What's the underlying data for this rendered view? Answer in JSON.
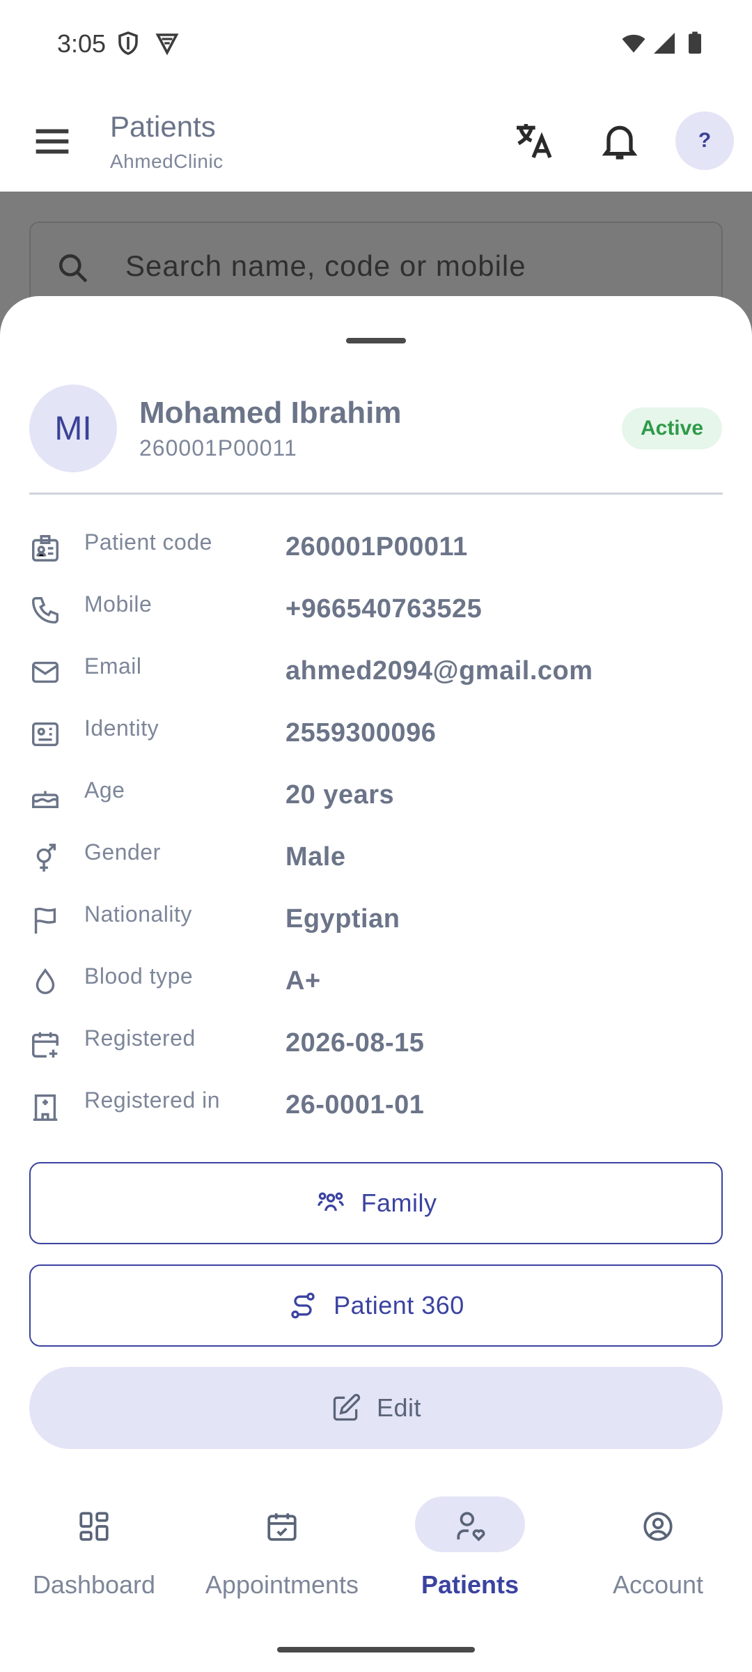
{
  "status_bar": {
    "time": "3:05"
  },
  "app_bar": {
    "title": "Patients",
    "subtitle": "AhmedClinic",
    "help_label": "?"
  },
  "search": {
    "placeholder": "Search name, code or mobile"
  },
  "patient": {
    "initials": "MI",
    "name": "Mohamed Ibrahim",
    "code": "260001P00011",
    "status": "Active"
  },
  "details": [
    {
      "icon": "id-badge-icon",
      "label": "Patient code",
      "value": "260001P00011"
    },
    {
      "icon": "phone-icon",
      "label": "Mobile",
      "value": "+966540763525"
    },
    {
      "icon": "mail-icon",
      "label": "Email",
      "value": "ahmed2094@gmail.com"
    },
    {
      "icon": "id-card-icon",
      "label": "Identity",
      "value": "2559300096"
    },
    {
      "icon": "cake-icon",
      "label": "Age",
      "value": "20 years"
    },
    {
      "icon": "gender-icon",
      "label": "Gender",
      "value": "Male"
    },
    {
      "icon": "flag-icon",
      "label": "Nationality",
      "value": "Egyptian"
    },
    {
      "icon": "droplet-icon",
      "label": "Blood type",
      "value": "A+"
    },
    {
      "icon": "calendar-plus-icon",
      "label": "Registered",
      "value": "2026-08-15"
    },
    {
      "icon": "hospital-icon",
      "label": "Registered in",
      "value": "26-0001-01"
    }
  ],
  "actions": {
    "family": "Family",
    "patient_360": "Patient 360",
    "edit": "Edit"
  },
  "bottom_nav": [
    {
      "label": "Dashboard",
      "icon": "dashboard-icon",
      "active": false
    },
    {
      "label": "Appointments",
      "icon": "calendar-check-icon",
      "active": false
    },
    {
      "label": "Patients",
      "icon": "user-heart-icon",
      "active": true
    },
    {
      "label": "Account",
      "icon": "user-circle-icon",
      "active": false
    }
  ],
  "colors": {
    "accent": "#3b43a0",
    "accent_soft": "#e3e4f6",
    "active_badge": "#2f9a4a",
    "text": "#6b7488"
  }
}
